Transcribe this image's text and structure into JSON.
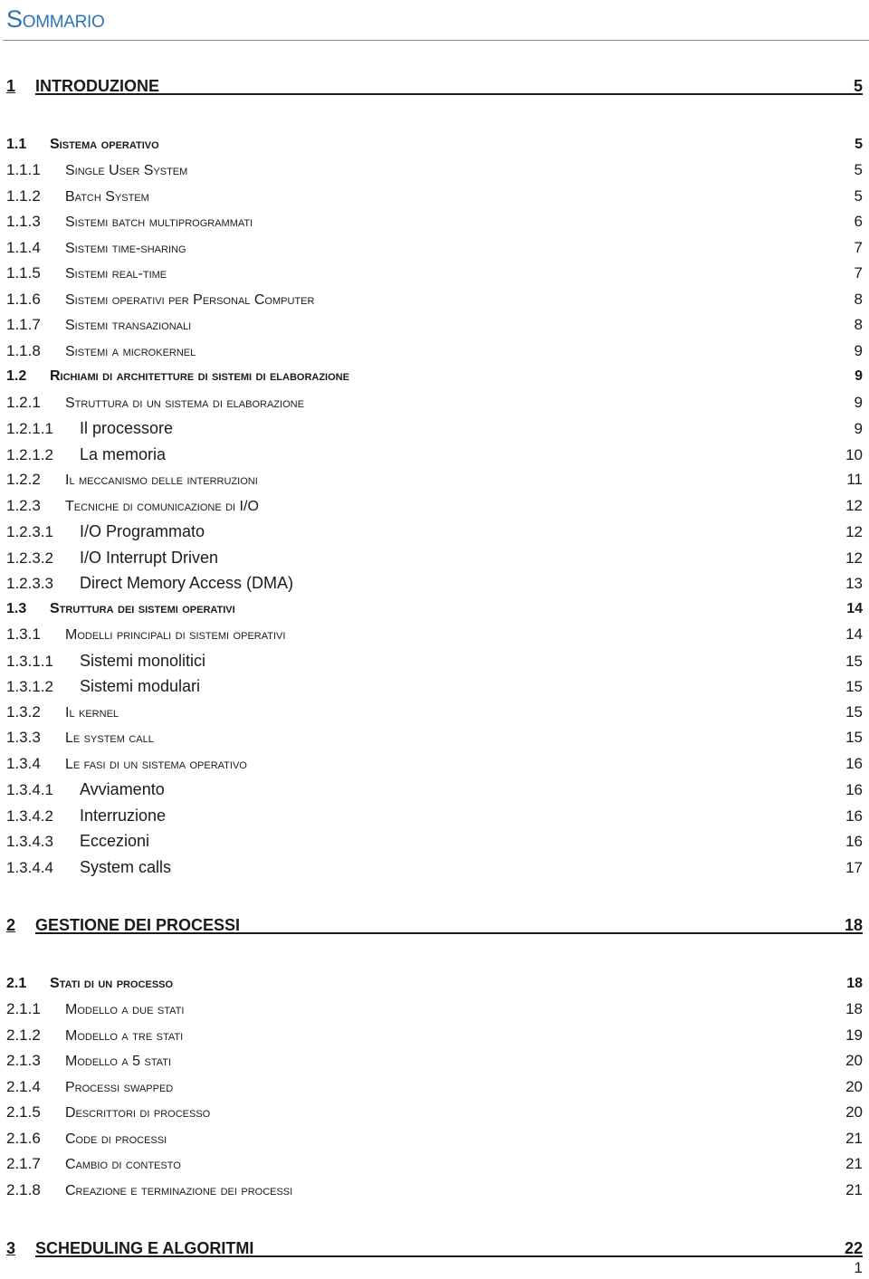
{
  "document": {
    "title": "Sommario",
    "page_number": "1",
    "accent_color": "#2e74b5"
  },
  "toc": [
    {
      "level": 1,
      "num": "1",
      "label": "INTRODUZIONE",
      "page": "5"
    },
    {
      "level": 2,
      "num": "1.1",
      "label": "Sistema operativo",
      "page": "5"
    },
    {
      "level": 3,
      "num": "1.1.1",
      "label": "Single User System",
      "page": "5"
    },
    {
      "level": 3,
      "num": "1.1.2",
      "label": "Batch System",
      "page": "5"
    },
    {
      "level": 3,
      "num": "1.1.3",
      "label": "Sistemi batch multiprogrammati",
      "page": "6"
    },
    {
      "level": 3,
      "num": "1.1.4",
      "label": "Sistemi time-sharing",
      "page": "7"
    },
    {
      "level": 3,
      "num": "1.1.5",
      "label": "Sistemi real-time",
      "page": "7"
    },
    {
      "level": 3,
      "num": "1.1.6",
      "label": "Sistemi operativi per Personal Computer",
      "page": "8"
    },
    {
      "level": 3,
      "num": "1.1.7",
      "label": "Sistemi transazionali",
      "page": "8"
    },
    {
      "level": 3,
      "num": "1.1.8",
      "label": "Sistemi a microkernel",
      "page": "9"
    },
    {
      "level": 2,
      "num": "1.2",
      "label": "Richiami di architetture di sistemi di elaborazione",
      "page": "9"
    },
    {
      "level": 3,
      "num": "1.2.1",
      "label": "Struttura di un sistema di elaborazione",
      "page": "9"
    },
    {
      "level": 4,
      "num": "1.2.1.1",
      "label": "Il processore",
      "page": "9"
    },
    {
      "level": 4,
      "num": "1.2.1.2",
      "label": "La memoria",
      "page": "10"
    },
    {
      "level": 3,
      "num": "1.2.2",
      "label": "Il meccanismo delle interruzioni",
      "page": "11"
    },
    {
      "level": 3,
      "num": "1.2.3",
      "label": "Tecniche di comunicazione di I/O",
      "page": "12"
    },
    {
      "level": 4,
      "num": "1.2.3.1",
      "label": "I/O Programmato",
      "page": "12"
    },
    {
      "level": 4,
      "num": "1.2.3.2",
      "label": "I/O Interrupt Driven",
      "page": "12"
    },
    {
      "level": 4,
      "num": "1.2.3.3",
      "label": "Direct Memory Access (DMA)",
      "page": "13"
    },
    {
      "level": 2,
      "num": "1.3",
      "label": "Struttura dei sistemi operativi",
      "page": "14"
    },
    {
      "level": 3,
      "num": "1.3.1",
      "label": "Modelli principali di sistemi operativi",
      "page": "14"
    },
    {
      "level": 4,
      "num": "1.3.1.1",
      "label": "Sistemi monolitici",
      "page": "15"
    },
    {
      "level": 4,
      "num": "1.3.1.2",
      "label": "Sistemi modulari",
      "page": "15"
    },
    {
      "level": 3,
      "num": "1.3.2",
      "label": "Il kernel",
      "page": "15"
    },
    {
      "level": 3,
      "num": "1.3.3",
      "label": "Le system call",
      "page": "15"
    },
    {
      "level": 3,
      "num": "1.3.4",
      "label": "Le fasi di un sistema operativo",
      "page": "16"
    },
    {
      "level": 4,
      "num": "1.3.4.1",
      "label": "Avviamento",
      "page": "16"
    },
    {
      "level": 4,
      "num": "1.3.4.2",
      "label": "Interruzione",
      "page": "16"
    },
    {
      "level": 4,
      "num": "1.3.4.3",
      "label": "Eccezioni",
      "page": "16"
    },
    {
      "level": 4,
      "num": "1.3.4.4",
      "label": "System calls",
      "page": "17"
    },
    {
      "level": 1,
      "num": "2",
      "label": "GESTIONE DEI PROCESSI",
      "page": "18"
    },
    {
      "level": 2,
      "num": "2.1",
      "label": "Stati di un processo",
      "page": "18"
    },
    {
      "level": 3,
      "num": "2.1.1",
      "label": "Modello a due stati",
      "page": "18"
    },
    {
      "level": 3,
      "num": "2.1.2",
      "label": "Modello a tre stati",
      "page": "19"
    },
    {
      "level": 3,
      "num": "2.1.3",
      "label": "Modello a 5 stati",
      "page": "20"
    },
    {
      "level": 3,
      "num": "2.1.4",
      "label": "Processi swapped",
      "page": "20"
    },
    {
      "level": 3,
      "num": "2.1.5",
      "label": "Descrittori di processo",
      "page": "20"
    },
    {
      "level": 3,
      "num": "2.1.6",
      "label": "Code di processi",
      "page": "21"
    },
    {
      "level": 3,
      "num": "2.1.7",
      "label": "Cambio di contesto",
      "page": "21"
    },
    {
      "level": 3,
      "num": "2.1.8",
      "label": "Creazione e terminazione dei processi",
      "page": "21"
    },
    {
      "level": 1,
      "num": "3",
      "label": "SCHEDULING E ALGORITMI",
      "page": "22"
    }
  ]
}
